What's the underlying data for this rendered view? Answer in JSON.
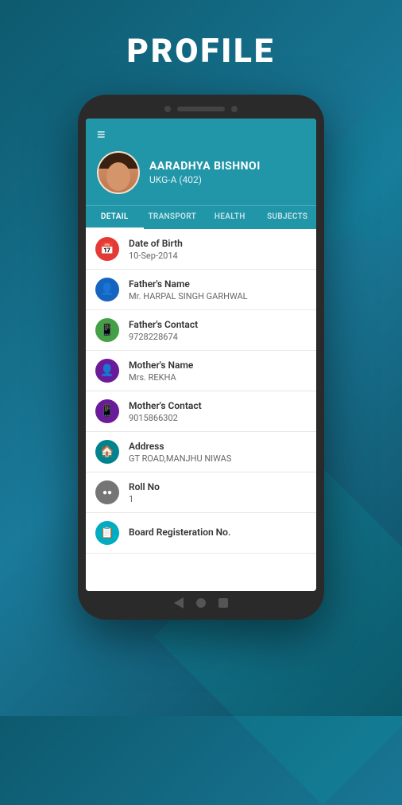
{
  "page": {
    "title": "PROFILE"
  },
  "profile": {
    "name": "AARADHYA BISHNOI",
    "class": "UKG-A (402)"
  },
  "tabs": [
    {
      "label": "DETAIL",
      "active": true
    },
    {
      "label": "TRANSPORT",
      "active": false
    },
    {
      "label": "HEALTH",
      "active": false
    },
    {
      "label": "SUBJECTS",
      "active": false
    }
  ],
  "items": [
    {
      "icon": "📅",
      "icon_class": "icon-red",
      "label": "Date of Birth",
      "value": "10-Sep-2014"
    },
    {
      "icon": "👤",
      "icon_class": "icon-blue",
      "label": "Father's Name",
      "value": "Mr. HARPAL SINGH GARHWAL"
    },
    {
      "icon": "📱",
      "icon_class": "icon-green",
      "label": "Father's Contact",
      "value": "9728228674"
    },
    {
      "icon": "👤",
      "icon_class": "icon-purple",
      "label": "Mother's Name",
      "value": "Mrs. REKHA"
    },
    {
      "icon": "📱",
      "icon_class": "icon-purple",
      "label": "Mother's Contact",
      "value": "9015866302"
    },
    {
      "icon": "🏠",
      "icon_class": "icon-teal",
      "label": "Address",
      "value": "GT ROAD,MANJHU NIWAS"
    },
    {
      "icon": "⚪",
      "icon_class": "icon-gray",
      "label": "Roll No",
      "value": "1"
    },
    {
      "icon": "📋",
      "icon_class": "icon-cyan",
      "label": "Board Registeration No.",
      "value": ""
    }
  ],
  "icons": {
    "hamburger": "≡",
    "calendar": "📅",
    "person": "👤",
    "phone": "📱",
    "home": "🏠",
    "circle": "⚪",
    "clipboard": "📋"
  }
}
